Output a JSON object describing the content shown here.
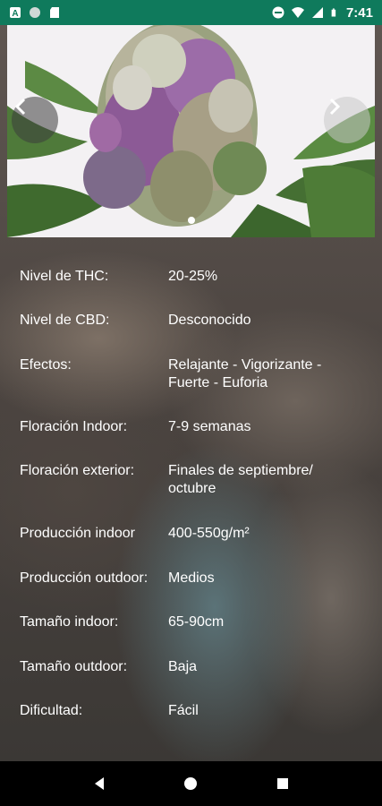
{
  "status_bar": {
    "time": "7:41",
    "left_icons": [
      "notification-a-icon",
      "circle-icon",
      "sd-card-icon"
    ],
    "right_icons": [
      "do-not-disturb-icon",
      "wifi-icon",
      "signal-icon",
      "battery-icon"
    ]
  },
  "carousel": {
    "prev_icon": "chevron-left-icon",
    "next_icon": "chevron-right-icon",
    "pages": 1,
    "active_page": 1
  },
  "details": [
    {
      "label": "Nivel de THC:",
      "value_lines": [
        "20-25%"
      ]
    },
    {
      "label": "Nivel de CBD:",
      "value_lines": [
        "Desconocido"
      ]
    },
    {
      "label": "Efectos:",
      "value_lines": [
        "Relajante - Vigorizante -",
        "Fuerte - Euforia"
      ]
    },
    {
      "label": "Floración Indoor:",
      "value_lines": [
        "7-9 semanas"
      ]
    },
    {
      "label": "Floración exterior:",
      "value_lines": [
        "Finales de septiembre/",
        "octubre"
      ]
    },
    {
      "label": "Producción indoor",
      "value_lines": [
        "400-550g/m²"
      ]
    },
    {
      "label": "Producción outdoor:",
      "value_lines": [
        "Medios"
      ]
    },
    {
      "label": "Tamaño indoor:",
      "value_lines": [
        "65-90cm"
      ]
    },
    {
      "label": "Tamaño outdoor:",
      "value_lines": [
        "Baja"
      ]
    },
    {
      "label": "Dificultad:",
      "value_lines": [
        "Fácil"
      ]
    }
  ],
  "navigation_bar": {
    "back_icon": "back-triangle-icon",
    "home_icon": "home-circle-icon",
    "recents_icon": "recents-square-icon"
  },
  "colors": {
    "status_bar": "#0f7a5c",
    "text": "#ffffff",
    "nav_bar": "#000000"
  }
}
